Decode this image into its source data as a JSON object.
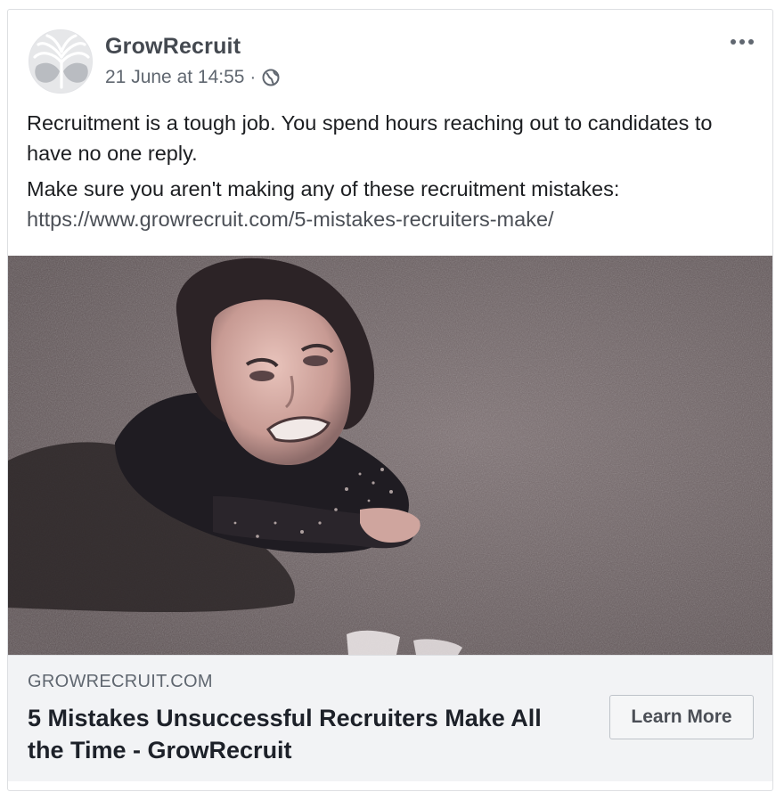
{
  "post": {
    "page_name": "GrowRecruit",
    "timestamp": "21 June at 14:55",
    "separator": "·",
    "privacy_icon": "globe-icon",
    "menu_icon": "more-options-icon",
    "text": {
      "paragraph_1": "Recruitment is a tough job. You spend hours reaching out to candidates to have no one reply.",
      "paragraph_2": "Make sure you aren't making any of these recruitment mistakes:",
      "link": "https://www.growrecruit.com/5-mistakes-recruiters-make/"
    }
  },
  "link_preview": {
    "domain": "GROWRECRUIT.COM",
    "headline": "5 Mistakes Unsuccessful Recruiters Make All the Time - GrowRecruit",
    "cta_label": "Learn More"
  },
  "colors": {
    "link_text": "#4b4f56",
    "preview_bg": "#f2f3f5",
    "image_tone": "#6d6061"
  }
}
